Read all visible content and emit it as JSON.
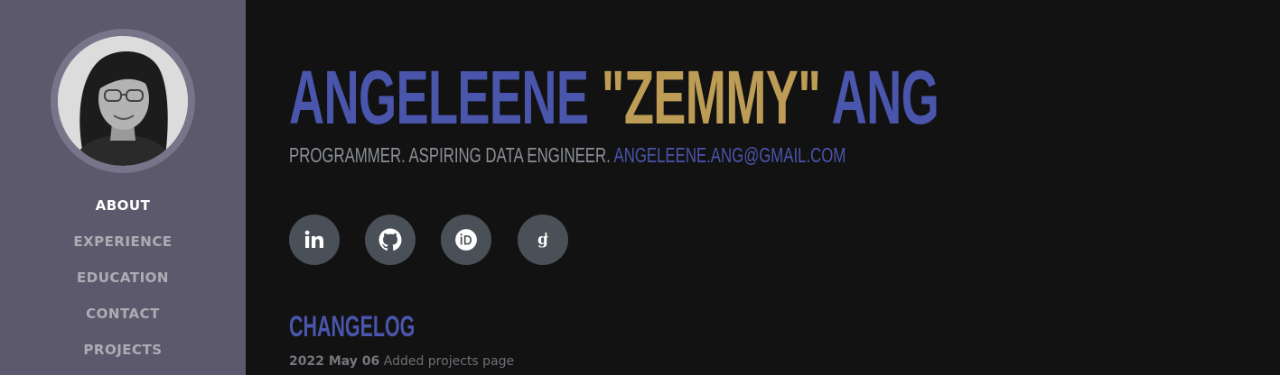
{
  "profile": {
    "first_name": "ANGELEENE",
    "nickname": "\"ZEMMY\"",
    "last_name": "ANG",
    "tagline": "PROGRAMMER. ASPIRING DATA ENGINEER.",
    "email": "ANGELEENE.ANG@GMAIL.COM"
  },
  "nav": {
    "items": [
      {
        "label": "ABOUT",
        "active": true
      },
      {
        "label": "EXPERIENCE",
        "active": false
      },
      {
        "label": "EDUCATION",
        "active": false
      },
      {
        "label": "CONTACT",
        "active": false
      },
      {
        "label": "PROJECTS",
        "active": false
      }
    ]
  },
  "socials": [
    {
      "icon": "linkedin-icon"
    },
    {
      "icon": "github-icon"
    },
    {
      "icon": "orcid-icon"
    },
    {
      "icon": "google-scholar-icon"
    }
  ],
  "changelog": {
    "title": "CHANGELOG",
    "entries": [
      {
        "date": "2022 May 06",
        "text": "Added projects page"
      }
    ]
  },
  "colors": {
    "sidebar": "#5b596b",
    "background": "#121212",
    "accent_blue": "#4a55ac",
    "accent_gold": "#bd9c56",
    "social_button": "#495057"
  }
}
